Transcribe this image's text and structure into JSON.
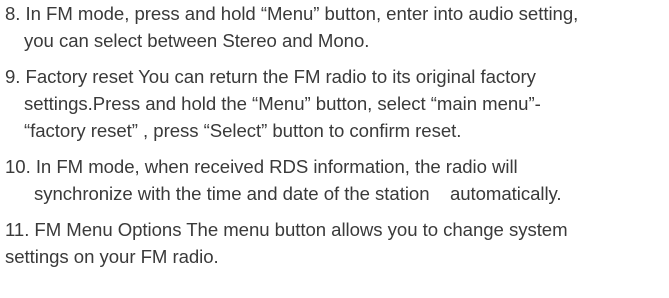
{
  "items": [
    {
      "lines": [
        "8. In FM mode, press and hold “Menu” button, enter into audio setting,",
        "you can select between Stereo and Mono."
      ]
    },
    {
      "lines": [
        "9. Factory reset You can return the FM radio to its original factory",
        "settings.Press and hold the “Menu” button, select “main menu”-",
        "“factory reset” , press “Select” button to confirm reset."
      ]
    },
    {
      "lines": [
        "10. In FM mode, when received RDS information, the radio will",
        "synchronize with the time and date of the station    automatically."
      ]
    },
    {
      "lines": [
        "11. FM Menu Options The menu button allows you to change system",
        "settings on your FM radio."
      ]
    }
  ]
}
